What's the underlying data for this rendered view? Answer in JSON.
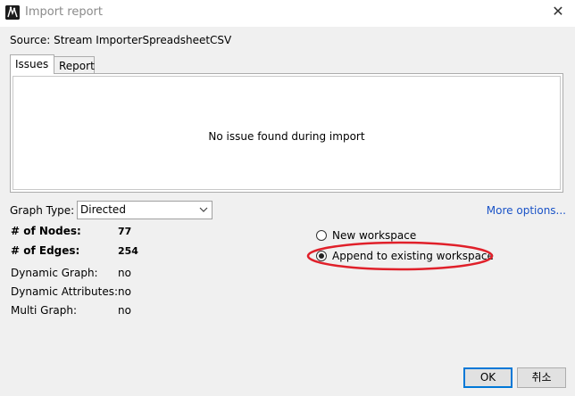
{
  "window": {
    "title": "Import report",
    "close_glyph": "✕"
  },
  "source": {
    "text": "Source: Stream ImporterSpreadsheetCSV"
  },
  "tabs": [
    {
      "label": "Issues",
      "selected": true
    },
    {
      "label": "Report",
      "selected": false
    }
  ],
  "issues": {
    "message": "No issue found during import"
  },
  "graph_type": {
    "label": "Graph Type:",
    "value": "Directed"
  },
  "more_options": "More options...",
  "stats": {
    "nodes_label": "# of Nodes:",
    "nodes_value": "77",
    "edges_label": "# of Edges:",
    "edges_value": "254",
    "dynamic_graph_label": "Dynamic Graph:",
    "dynamic_graph_value": "no",
    "dynamic_attributes_label": "Dynamic Attributes:",
    "dynamic_attributes_value": "no",
    "multi_graph_label": "Multi Graph:",
    "multi_graph_value": "no"
  },
  "workspace": {
    "options": [
      {
        "label": "New workspace",
        "selected": false
      },
      {
        "label": "Append to existing workspace",
        "selected": true
      }
    ],
    "highlight_color": "#e0202a"
  },
  "buttons": {
    "ok": "OK",
    "cancel": "취소"
  },
  "colors": {
    "link": "#1a53c7",
    "ok_border": "#0078d7"
  }
}
